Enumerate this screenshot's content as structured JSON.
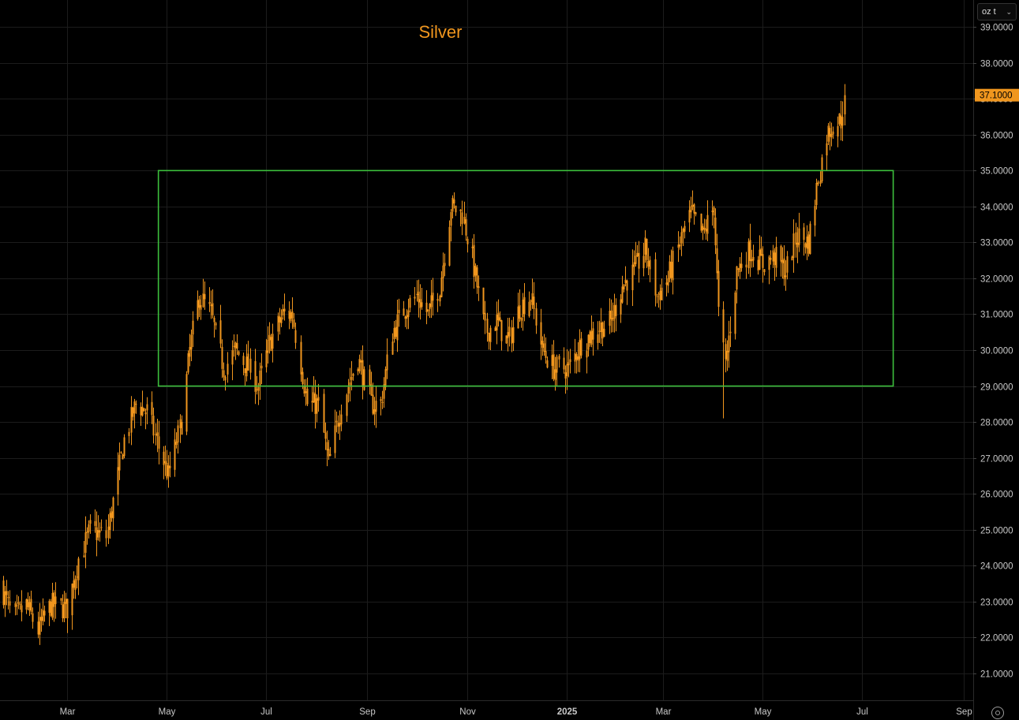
{
  "unit_selector": {
    "value": "oz t",
    "icon": "chevron-down-icon"
  },
  "settings": {
    "icon": "gear-icon"
  },
  "colors": {
    "background": "#000000",
    "grid": "#1c1c1c",
    "candle": "#f0961e",
    "title": "#f0961e",
    "box": "#3cbf3c",
    "axis_text": "#c8c8c8",
    "last_price_bg": "#f0961e",
    "last_price_text": "#000000"
  },
  "chart_data": {
    "type": "candlestick",
    "title": "Silver",
    "x_range": [
      "2024-01-20",
      "2025-09-07"
    ],
    "ylim": [
      20.25,
      39.75
    ],
    "y_ticks": [
      21,
      22,
      23,
      24,
      25,
      26,
      27,
      28,
      29,
      30,
      31,
      32,
      33,
      34,
      35,
      36,
      37,
      38,
      39
    ],
    "y_tick_labels": [
      "21.0000",
      "22.0000",
      "23.0000",
      "24.0000",
      "25.0000",
      "26.0000",
      "27.0000",
      "28.0000",
      "29.0000",
      "30.0000",
      "31.0000",
      "32.0000",
      "33.0000",
      "34.0000",
      "35.0000",
      "36.0000",
      "37.0000",
      "38.0000",
      "39.0000"
    ],
    "x_ticks": [
      {
        "label": "Mar",
        "date": "2024-03-01"
      },
      {
        "label": "May",
        "date": "2024-05-01"
      },
      {
        "label": "Jul",
        "date": "2024-07-01"
      },
      {
        "label": "Sep",
        "date": "2024-09-01"
      },
      {
        "label": "Nov",
        "date": "2024-11-01"
      },
      {
        "label": "2025",
        "date": "2025-01-01"
      },
      {
        "label": "Mar",
        "date": "2025-03-01"
      },
      {
        "label": "May",
        "date": "2025-05-01"
      },
      {
        "label": "Jul",
        "date": "2025-07-01"
      },
      {
        "label": "Sep",
        "date": "2025-09-01"
      }
    ],
    "price_anchors": [
      [
        "2024-01-20",
        23.5
      ],
      [
        "2024-01-28",
        22.5
      ],
      [
        "2024-02-05",
        22.9
      ],
      [
        "2024-02-12",
        22.2
      ],
      [
        "2024-02-20",
        22.9
      ],
      [
        "2024-03-01",
        22.8
      ],
      [
        "2024-03-08",
        24.2
      ],
      [
        "2024-03-15",
        25.0
      ],
      [
        "2024-03-25",
        24.8
      ],
      [
        "2024-04-05",
        27.5
      ],
      [
        "2024-04-12",
        28.5
      ],
      [
        "2024-04-19",
        28.3
      ],
      [
        "2024-04-26",
        27.3
      ],
      [
        "2024-05-02",
        26.5
      ],
      [
        "2024-05-10",
        28.0
      ],
      [
        "2024-05-15",
        30.0
      ],
      [
        "2024-05-21",
        31.5
      ],
      [
        "2024-05-28",
        31.0
      ],
      [
        "2024-06-05",
        29.5
      ],
      [
        "2024-06-12",
        30.0
      ],
      [
        "2024-06-20",
        29.5
      ],
      [
        "2024-06-26",
        29.0
      ],
      [
        "2024-07-03",
        30.2
      ],
      [
        "2024-07-11",
        31.0
      ],
      [
        "2024-07-17",
        31.0
      ],
      [
        "2024-07-26",
        28.5
      ],
      [
        "2024-08-02",
        28.5
      ],
      [
        "2024-08-08",
        26.8
      ],
      [
        "2024-08-16",
        28.5
      ],
      [
        "2024-08-26",
        29.8
      ],
      [
        "2024-09-03",
        28.5
      ],
      [
        "2024-09-09",
        28.5
      ],
      [
        "2024-09-16",
        30.5
      ],
      [
        "2024-09-24",
        31.2
      ],
      [
        "2024-10-01",
        31.5
      ],
      [
        "2024-10-08",
        31.0
      ],
      [
        "2024-10-15",
        31.8
      ],
      [
        "2024-10-22",
        34.0
      ],
      [
        "2024-10-29",
        33.8
      ],
      [
        "2024-11-05",
        32.3
      ],
      [
        "2024-11-12",
        30.5
      ],
      [
        "2024-11-19",
        30.8
      ],
      [
        "2024-11-26",
        30.2
      ],
      [
        "2024-12-03",
        31.2
      ],
      [
        "2024-12-10",
        31.5
      ],
      [
        "2024-12-17",
        30.0
      ],
      [
        "2024-12-24",
        29.5
      ],
      [
        "2025-01-02",
        29.5
      ],
      [
        "2025-01-10",
        30.2
      ],
      [
        "2025-01-20",
        30.6
      ],
      [
        "2025-01-28",
        30.8
      ],
      [
        "2025-02-04",
        31.8
      ],
      [
        "2025-02-11",
        32.2
      ],
      [
        "2025-02-18",
        32.8
      ],
      [
        "2025-02-25",
        31.5
      ],
      [
        "2025-03-04",
        32.0
      ],
      [
        "2025-03-11",
        33.0
      ],
      [
        "2025-03-18",
        33.8
      ],
      [
        "2025-03-25",
        33.2
      ],
      [
        "2025-04-01",
        34.0
      ],
      [
        "2025-04-04",
        31.0
      ],
      [
        "2025-04-08",
        29.6
      ],
      [
        "2025-04-15",
        32.2
      ],
      [
        "2025-04-23",
        32.8
      ],
      [
        "2025-05-01",
        32.4
      ],
      [
        "2025-05-08",
        32.6
      ],
      [
        "2025-05-15",
        32.2
      ],
      [
        "2025-05-22",
        33.2
      ],
      [
        "2025-05-29",
        33.0
      ],
      [
        "2025-06-04",
        34.8
      ],
      [
        "2025-06-09",
        36.0
      ],
      [
        "2025-06-13",
        36.3
      ],
      [
        "2025-06-18",
        36.4
      ],
      [
        "2025-06-20",
        37.1
      ]
    ],
    "range_box": {
      "start": "2024-04-26",
      "end": "2025-07-20",
      "low": 29.0,
      "high": 35.0,
      "color": "#3cbf3c"
    },
    "last_price": {
      "value": 37.1,
      "label": "37.1000"
    }
  }
}
